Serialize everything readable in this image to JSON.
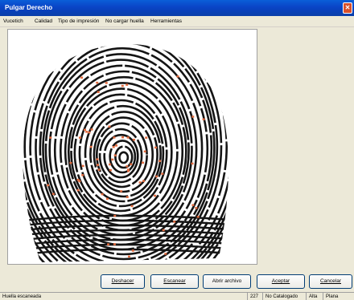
{
  "window": {
    "title": "Pulgar Derecho",
    "close_glyph": "✕"
  },
  "menu": [
    "Vucetich",
    "Calidad",
    "Tipo de impresión",
    "No cargar huella",
    "Herramientas"
  ],
  "image": {
    "minutia_color": "#E06A3E",
    "ridge_color": "#141414"
  },
  "buttons": {
    "deshacer": "Deshacer",
    "escanear": "Escanear",
    "abrir": "Abrir archivo",
    "aceptar": "Aceptar",
    "cancelar": "Cancelar"
  },
  "status": {
    "message": "Huella escaneada",
    "quality": "227",
    "catalog": "No Catalogado",
    "level": "Alta",
    "type": "Plana"
  }
}
